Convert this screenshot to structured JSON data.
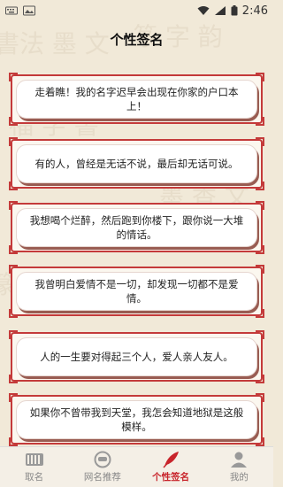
{
  "status_bar": {
    "time": "2:46",
    "icons": [
      "keyboard-icon",
      "image-icon",
      "wifi-icon",
      "signal-icon",
      "battery-icon"
    ]
  },
  "header": {
    "title": "个性签名"
  },
  "signatures": [
    {
      "text": "走着瞧！我的名字迟早会出现在你家的户口本上！"
    },
    {
      "text": "有的人，曾经是无话不说，最后却无话可说。"
    },
    {
      "text": "我想喝个烂醉，然后跑到你楼下，跟你说一大堆的情话。"
    },
    {
      "text": "我曾明白爱情不是一切，却发现一切都不是爱情。"
    },
    {
      "text": "人的一生要对得起三个人，爱人亲人友人。"
    },
    {
      "text": "如果你不曾带我到天堂，我怎会知道地狱是这般模样。"
    }
  ],
  "bottom_nav": {
    "active_index": 2,
    "active_color": "#c8242b",
    "items": [
      {
        "label": "取名",
        "icon": "calligraphy-icon"
      },
      {
        "label": "网名推荐",
        "icon": "mask-icon"
      },
      {
        "label": "个性签名",
        "icon": "feather-icon"
      },
      {
        "label": "我的",
        "icon": "person-icon"
      }
    ]
  }
}
